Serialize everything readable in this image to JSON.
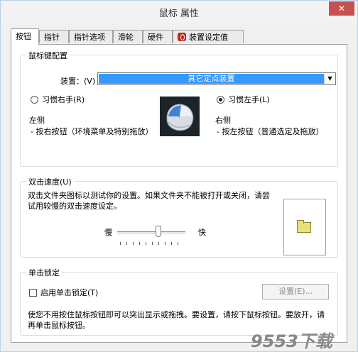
{
  "window": {
    "title": "鼠标 属性",
    "close_label": "✕"
  },
  "tabs": [
    {
      "label": "按钮"
    },
    {
      "label": "指针"
    },
    {
      "label": "指针选项"
    },
    {
      "label": "滑轮"
    },
    {
      "label": "硬件"
    },
    {
      "label": "装置设定值"
    }
  ],
  "button_config": {
    "group_title": "鼠标键配置",
    "device_label": "装置：(V)",
    "device_value": "其它定点装置",
    "right_hand_label": "习惯右手(R)",
    "left_hand_label": "习惯左手(L)",
    "left_side_title": "左侧",
    "left_side_desc": "- 按右按钮（环境菜单及特别拖放）",
    "right_side_title": "右侧",
    "right_side_desc": "- 按左按钮（普通选定及拖放）"
  },
  "double_click": {
    "group_title": "双击速度(U)",
    "desc": "双击文件夹图标以测试你的设置。如果文件夹不能被打开或关闭，请尝试用较慢的双击速度设定。",
    "slow_label": "慢",
    "fast_label": "快",
    "speed_fraction": 0.6
  },
  "click_lock": {
    "group_title": "单击锁定",
    "enable_label": "启用单击锁定(T)",
    "settings_button": "设置(E)...",
    "desc": "使您不用按住鼠标按钮即可以突出显示或拖拽。要设置，请按下鼠标按钮。要放开，请再单击鼠标按钮。"
  },
  "watermark": "9553下载"
}
